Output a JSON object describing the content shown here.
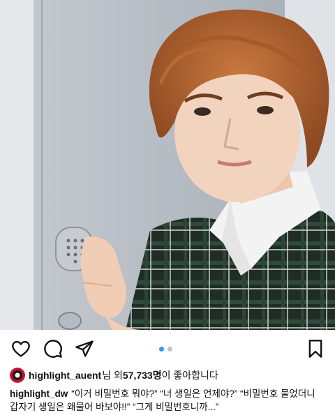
{
  "post": {
    "photo": {
      "icon": "selfie-photo"
    },
    "actions": {
      "like_icon": "heart-icon",
      "comment_icon": "comment-icon",
      "share_icon": "send-icon",
      "save_icon": "bookmark-icon"
    },
    "carousel": {
      "total": 2,
      "active": 1
    },
    "likes": {
      "user": "highlight_auent",
      "mid": "님 외 ",
      "count": "57,733명",
      "suffix": "이 좋아합니다"
    },
    "caption": {
      "user": "highlight_dw",
      "line1": "“이거 비밀번호 뭐야?” “너 생일은 언제야?” “비밀번호 물었더니",
      "line2": "갑자기 생일은 왜물어 바보야!!” “그게 비밀번호니까...”"
    }
  },
  "colors": {
    "accent": "#3897f0",
    "text": "#111111"
  }
}
